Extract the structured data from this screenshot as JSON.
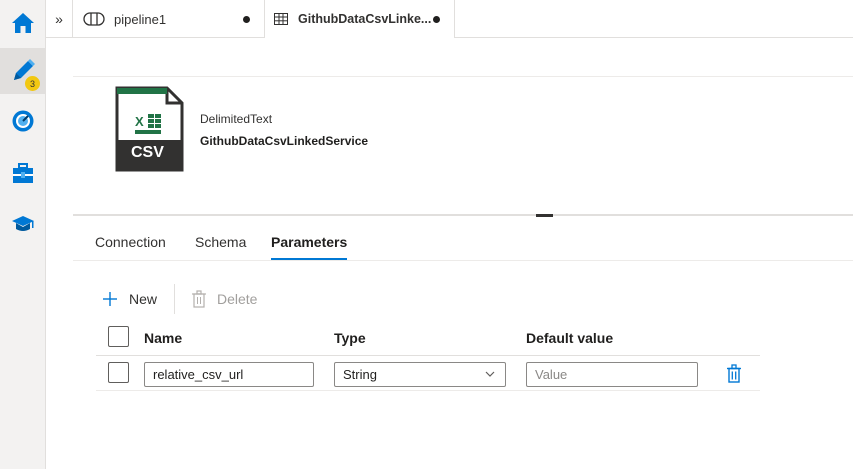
{
  "rail": {
    "badge_count": "3"
  },
  "tabs": [
    {
      "label": "pipeline1",
      "dirty": true
    },
    {
      "label": "GithubDataCsvLinke...",
      "dirty": true
    }
  ],
  "dataset": {
    "icon_label": "CSV",
    "type": "DelimitedText",
    "name": "GithubDataCsvLinkedService"
  },
  "subtabs": [
    {
      "label": "Connection",
      "active": false
    },
    {
      "label": "Schema",
      "active": false
    },
    {
      "label": "Parameters",
      "active": true
    }
  ],
  "toolbar": {
    "new_label": "New",
    "delete_label": "Delete"
  },
  "table": {
    "headers": [
      "Name",
      "Type",
      "Default value"
    ],
    "rows": [
      {
        "name": "relative_csv_url",
        "type": "String",
        "default_placeholder": "Value"
      }
    ]
  },
  "colors": {
    "accent": "#0078d4",
    "excel_green": "#217346",
    "badge": "#f2c811"
  }
}
